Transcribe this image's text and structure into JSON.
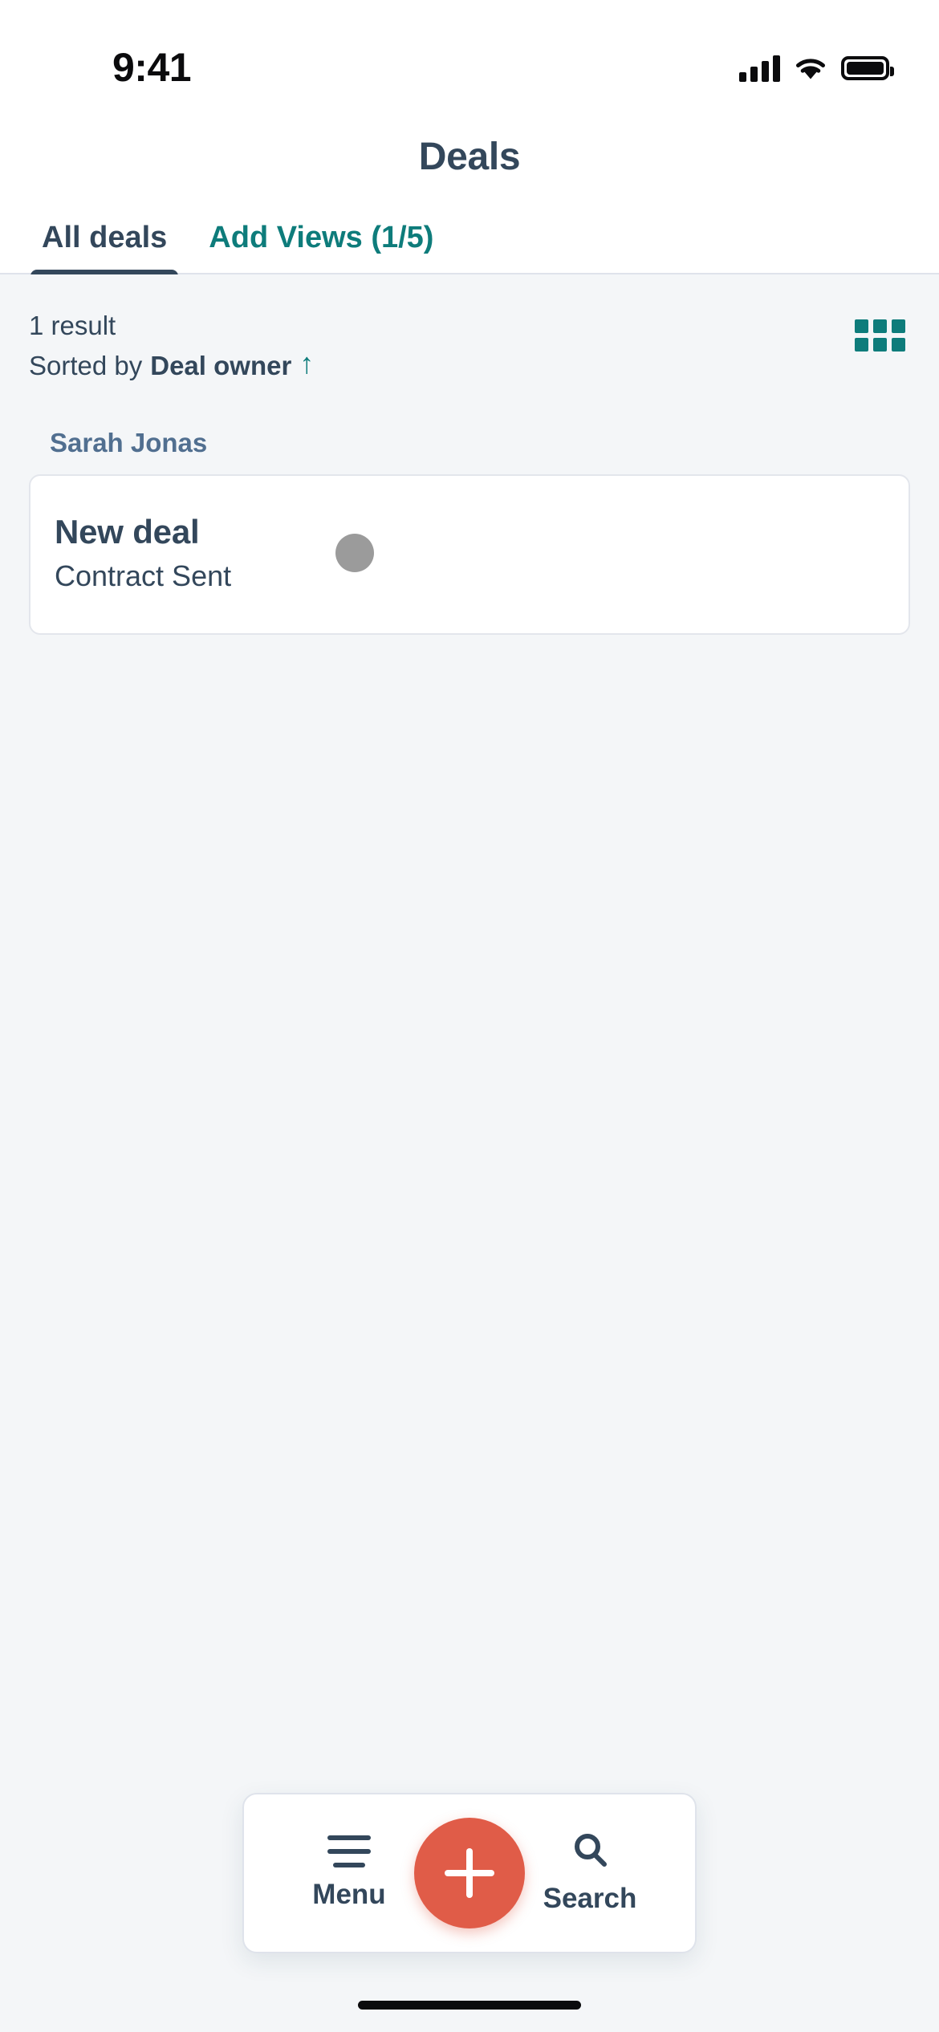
{
  "status_bar": {
    "time": "9:41",
    "cellular_icon": "signal-bars-icon",
    "wifi_icon": "wifi-icon",
    "battery_icon": "battery-icon"
  },
  "header": {
    "title": "Deals"
  },
  "tabs": [
    {
      "label": "All deals",
      "active": true
    },
    {
      "label": "Add Views (1/5)",
      "active": false
    }
  ],
  "list_toolbar": {
    "result_count": "1 result",
    "sorted_prefix": "Sorted by ",
    "sorted_field": "Deal owner",
    "sort_direction_icon": "arrow-up-icon",
    "view_toggle_icon": "grid-view-icon",
    "accent_color": "#0e7c7b"
  },
  "groups": [
    {
      "owner": "Sarah Jonas",
      "deals": [
        {
          "name": "New deal",
          "stage": "Contract Sent",
          "stage_dot_color": "#9b9b9b"
        }
      ]
    }
  ],
  "bottom_bar": {
    "menu_label": "Menu",
    "menu_icon": "hamburger-menu-icon",
    "create_icon": "plus-icon",
    "create_color": "#e05c48",
    "search_label": "Search",
    "search_icon": "search-icon"
  }
}
